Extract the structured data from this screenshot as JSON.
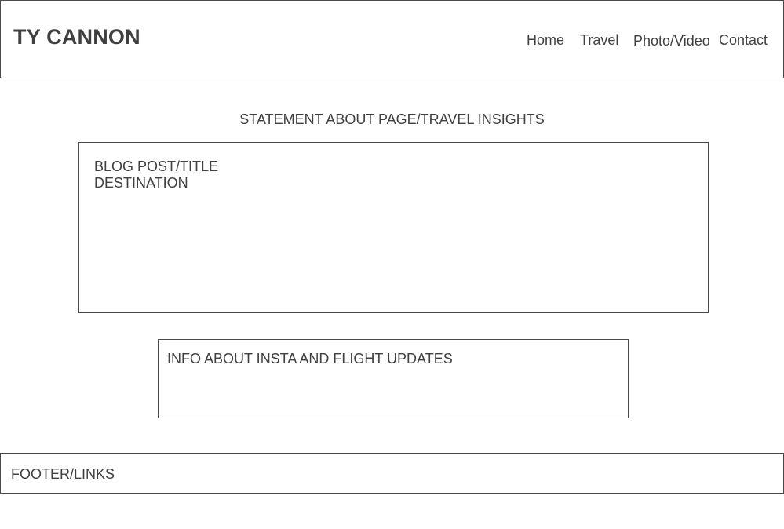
{
  "header": {
    "site_title": "TY CANNON",
    "nav": {
      "home": "Home",
      "travel": "Travel",
      "photo_video": "Photo/Video",
      "contact": "Contact"
    }
  },
  "main": {
    "statement": "STATEMENT ABOUT PAGE/TRAVEL INSIGHTS",
    "blog": {
      "title": "BLOG POST/TITLE",
      "destination": "DESTINATION"
    },
    "info": {
      "text": "INFO ABOUT INSTA AND FLIGHT UPDATES"
    }
  },
  "footer": {
    "text": "FOOTER/LINKS"
  },
  "colors": {
    "text": "#404040",
    "border": "#4a4a4a",
    "background": "#ffffff"
  }
}
